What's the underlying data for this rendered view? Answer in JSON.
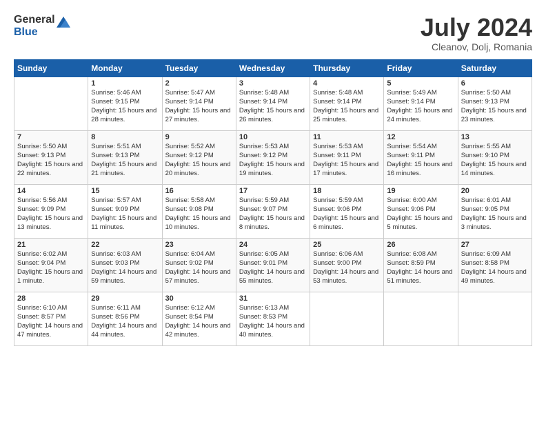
{
  "logo": {
    "general": "General",
    "blue": "Blue"
  },
  "title": "July 2024",
  "location": "Cleanov, Dolj, Romania",
  "days_header": [
    "Sunday",
    "Monday",
    "Tuesday",
    "Wednesday",
    "Thursday",
    "Friday",
    "Saturday"
  ],
  "weeks": [
    [
      {
        "day": "",
        "sunrise": "",
        "sunset": "",
        "daylight": ""
      },
      {
        "day": "1",
        "sunrise": "Sunrise: 5:46 AM",
        "sunset": "Sunset: 9:15 PM",
        "daylight": "Daylight: 15 hours and 28 minutes."
      },
      {
        "day": "2",
        "sunrise": "Sunrise: 5:47 AM",
        "sunset": "Sunset: 9:14 PM",
        "daylight": "Daylight: 15 hours and 27 minutes."
      },
      {
        "day": "3",
        "sunrise": "Sunrise: 5:48 AM",
        "sunset": "Sunset: 9:14 PM",
        "daylight": "Daylight: 15 hours and 26 minutes."
      },
      {
        "day": "4",
        "sunrise": "Sunrise: 5:48 AM",
        "sunset": "Sunset: 9:14 PM",
        "daylight": "Daylight: 15 hours and 25 minutes."
      },
      {
        "day": "5",
        "sunrise": "Sunrise: 5:49 AM",
        "sunset": "Sunset: 9:14 PM",
        "daylight": "Daylight: 15 hours and 24 minutes."
      },
      {
        "day": "6",
        "sunrise": "Sunrise: 5:50 AM",
        "sunset": "Sunset: 9:13 PM",
        "daylight": "Daylight: 15 hours and 23 minutes."
      }
    ],
    [
      {
        "day": "7",
        "sunrise": "Sunrise: 5:50 AM",
        "sunset": "Sunset: 9:13 PM",
        "daylight": "Daylight: 15 hours and 22 minutes."
      },
      {
        "day": "8",
        "sunrise": "Sunrise: 5:51 AM",
        "sunset": "Sunset: 9:13 PM",
        "daylight": "Daylight: 15 hours and 21 minutes."
      },
      {
        "day": "9",
        "sunrise": "Sunrise: 5:52 AM",
        "sunset": "Sunset: 9:12 PM",
        "daylight": "Daylight: 15 hours and 20 minutes."
      },
      {
        "day": "10",
        "sunrise": "Sunrise: 5:53 AM",
        "sunset": "Sunset: 9:12 PM",
        "daylight": "Daylight: 15 hours and 19 minutes."
      },
      {
        "day": "11",
        "sunrise": "Sunrise: 5:53 AM",
        "sunset": "Sunset: 9:11 PM",
        "daylight": "Daylight: 15 hours and 17 minutes."
      },
      {
        "day": "12",
        "sunrise": "Sunrise: 5:54 AM",
        "sunset": "Sunset: 9:11 PM",
        "daylight": "Daylight: 15 hours and 16 minutes."
      },
      {
        "day": "13",
        "sunrise": "Sunrise: 5:55 AM",
        "sunset": "Sunset: 9:10 PM",
        "daylight": "Daylight: 15 hours and 14 minutes."
      }
    ],
    [
      {
        "day": "14",
        "sunrise": "Sunrise: 5:56 AM",
        "sunset": "Sunset: 9:09 PM",
        "daylight": "Daylight: 15 hours and 13 minutes."
      },
      {
        "day": "15",
        "sunrise": "Sunrise: 5:57 AM",
        "sunset": "Sunset: 9:09 PM",
        "daylight": "Daylight: 15 hours and 11 minutes."
      },
      {
        "day": "16",
        "sunrise": "Sunrise: 5:58 AM",
        "sunset": "Sunset: 9:08 PM",
        "daylight": "Daylight: 15 hours and 10 minutes."
      },
      {
        "day": "17",
        "sunrise": "Sunrise: 5:59 AM",
        "sunset": "Sunset: 9:07 PM",
        "daylight": "Daylight: 15 hours and 8 minutes."
      },
      {
        "day": "18",
        "sunrise": "Sunrise: 5:59 AM",
        "sunset": "Sunset: 9:06 PM",
        "daylight": "Daylight: 15 hours and 6 minutes."
      },
      {
        "day": "19",
        "sunrise": "Sunrise: 6:00 AM",
        "sunset": "Sunset: 9:06 PM",
        "daylight": "Daylight: 15 hours and 5 minutes."
      },
      {
        "day": "20",
        "sunrise": "Sunrise: 6:01 AM",
        "sunset": "Sunset: 9:05 PM",
        "daylight": "Daylight: 15 hours and 3 minutes."
      }
    ],
    [
      {
        "day": "21",
        "sunrise": "Sunrise: 6:02 AM",
        "sunset": "Sunset: 9:04 PM",
        "daylight": "Daylight: 15 hours and 1 minute."
      },
      {
        "day": "22",
        "sunrise": "Sunrise: 6:03 AM",
        "sunset": "Sunset: 9:03 PM",
        "daylight": "Daylight: 14 hours and 59 minutes."
      },
      {
        "day": "23",
        "sunrise": "Sunrise: 6:04 AM",
        "sunset": "Sunset: 9:02 PM",
        "daylight": "Daylight: 14 hours and 57 minutes."
      },
      {
        "day": "24",
        "sunrise": "Sunrise: 6:05 AM",
        "sunset": "Sunset: 9:01 PM",
        "daylight": "Daylight: 14 hours and 55 minutes."
      },
      {
        "day": "25",
        "sunrise": "Sunrise: 6:06 AM",
        "sunset": "Sunset: 9:00 PM",
        "daylight": "Daylight: 14 hours and 53 minutes."
      },
      {
        "day": "26",
        "sunrise": "Sunrise: 6:08 AM",
        "sunset": "Sunset: 8:59 PM",
        "daylight": "Daylight: 14 hours and 51 minutes."
      },
      {
        "day": "27",
        "sunrise": "Sunrise: 6:09 AM",
        "sunset": "Sunset: 8:58 PM",
        "daylight": "Daylight: 14 hours and 49 minutes."
      }
    ],
    [
      {
        "day": "28",
        "sunrise": "Sunrise: 6:10 AM",
        "sunset": "Sunset: 8:57 PM",
        "daylight": "Daylight: 14 hours and 47 minutes."
      },
      {
        "day": "29",
        "sunrise": "Sunrise: 6:11 AM",
        "sunset": "Sunset: 8:56 PM",
        "daylight": "Daylight: 14 hours and 44 minutes."
      },
      {
        "day": "30",
        "sunrise": "Sunrise: 6:12 AM",
        "sunset": "Sunset: 8:54 PM",
        "daylight": "Daylight: 14 hours and 42 minutes."
      },
      {
        "day": "31",
        "sunrise": "Sunrise: 6:13 AM",
        "sunset": "Sunset: 8:53 PM",
        "daylight": "Daylight: 14 hours and 40 minutes."
      },
      {
        "day": "",
        "sunrise": "",
        "sunset": "",
        "daylight": ""
      },
      {
        "day": "",
        "sunrise": "",
        "sunset": "",
        "daylight": ""
      },
      {
        "day": "",
        "sunrise": "",
        "sunset": "",
        "daylight": ""
      }
    ]
  ]
}
